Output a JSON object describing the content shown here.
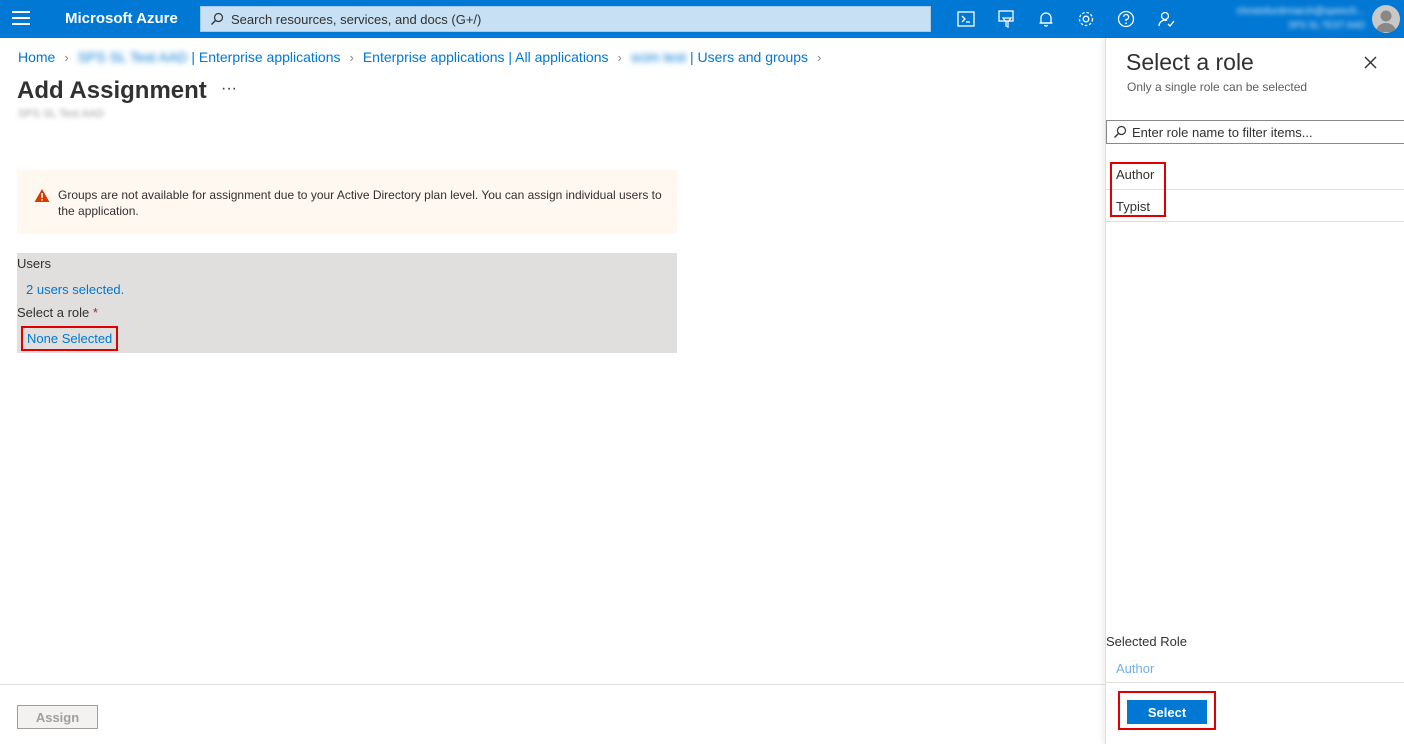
{
  "topbar": {
    "brand": "Microsoft Azure",
    "search_placeholder": "Search resources, services, and docs (G+/)",
    "account_email": "christofurdrmarch@speech...",
    "account_directory": "SPS SL TEST AAD",
    "icons": [
      "cloud-shell-icon",
      "directory-filter-icon",
      "notifications-icon",
      "settings-icon",
      "help-icon",
      "feedback-icon"
    ]
  },
  "breadcrumb": {
    "items": [
      "Home",
      "SPS SL Test AAD | Enterprise applications",
      "Enterprise applications | All applications",
      "scim test | Users and groups"
    ],
    "blurred_prefixes": [
      "SPS SL Test AAD",
      "scim test"
    ]
  },
  "page": {
    "title": "Add Assignment",
    "more_label": "···",
    "subtitle": "SPS SL Test AAD"
  },
  "warning": {
    "text": "Groups are not available for assignment due to your Active Directory plan level. You can assign individual users to the application."
  },
  "form": {
    "users_label": "Users",
    "users_value": "2 users selected.",
    "role_label": "Select a role",
    "role_required_mark": "*",
    "role_value": "None Selected"
  },
  "footer": {
    "assign_label": "Assign"
  },
  "role_panel": {
    "title": "Select a role",
    "subtitle": "Only a single role can be selected",
    "filter_placeholder": "Enter role name to filter items...",
    "roles": [
      "Author",
      "Typist"
    ],
    "selected_role_label": "Selected Role",
    "selected_role_value": "Author",
    "select_button_label": "Select"
  },
  "colors": {
    "accent": "#0078d4",
    "warning_bg": "#fff8f0",
    "warning_icon": "#d83b01",
    "highlight": "#e00000"
  }
}
